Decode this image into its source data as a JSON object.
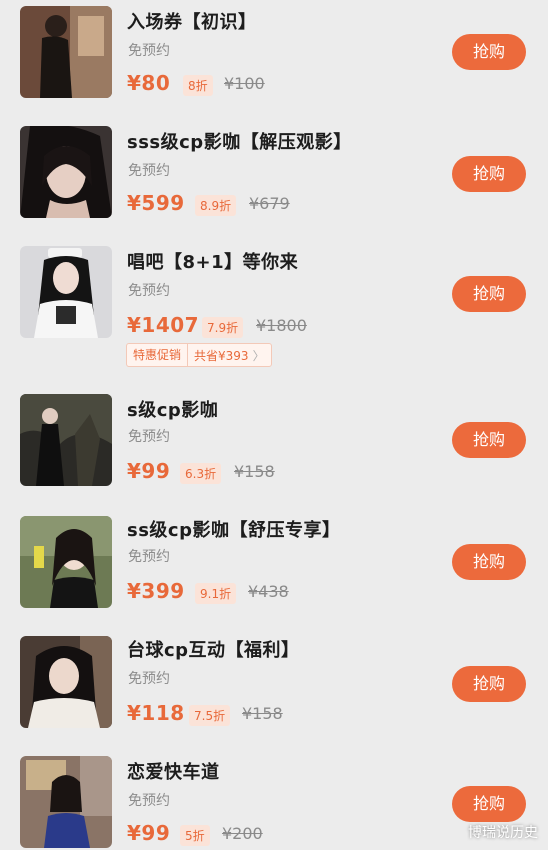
{
  "items": [
    {
      "title": "入场券【初识】",
      "subtitle": "免预约",
      "price": "¥80",
      "discount": "8折",
      "original_price": "¥100",
      "button_label": "抢购"
    },
    {
      "title": "sss级cp影咖【解压观影】",
      "subtitle": "免预约",
      "price": "¥599",
      "discount": "8.9折",
      "original_price": "¥679",
      "button_label": "抢购"
    },
    {
      "title": "唱吧【8+1】等你来",
      "subtitle": "免预约",
      "price": "¥1407",
      "discount": "7.9折",
      "original_price": "¥1800",
      "button_label": "抢购",
      "promo_tag": "特惠促销",
      "promo_saving": "共省¥393",
      "promo_arrow": "〉"
    },
    {
      "title": "s级cp影咖",
      "subtitle": "免预约",
      "price": "¥99",
      "discount": "6.3折",
      "original_price": "¥158",
      "button_label": "抢购"
    },
    {
      "title": "ss级cp影咖【舒压专享】",
      "subtitle": "免预约",
      "price": "¥399",
      "discount": "9.1折",
      "original_price": "¥438",
      "button_label": "抢购"
    },
    {
      "title": "台球cp互动【福利】",
      "subtitle": "免预约",
      "price": "¥118",
      "discount": "7.5折",
      "original_price": "¥158",
      "button_label": "抢购"
    },
    {
      "title": "恋爱快车道",
      "subtitle": "免预约",
      "price": "¥99",
      "discount": "5折",
      "original_price": "¥200",
      "button_label": "抢购"
    }
  ],
  "watermark": "博瑞说历史",
  "colors": {
    "accent": "#ec6a3c",
    "price": "#e8693a",
    "background": "#ececec"
  }
}
